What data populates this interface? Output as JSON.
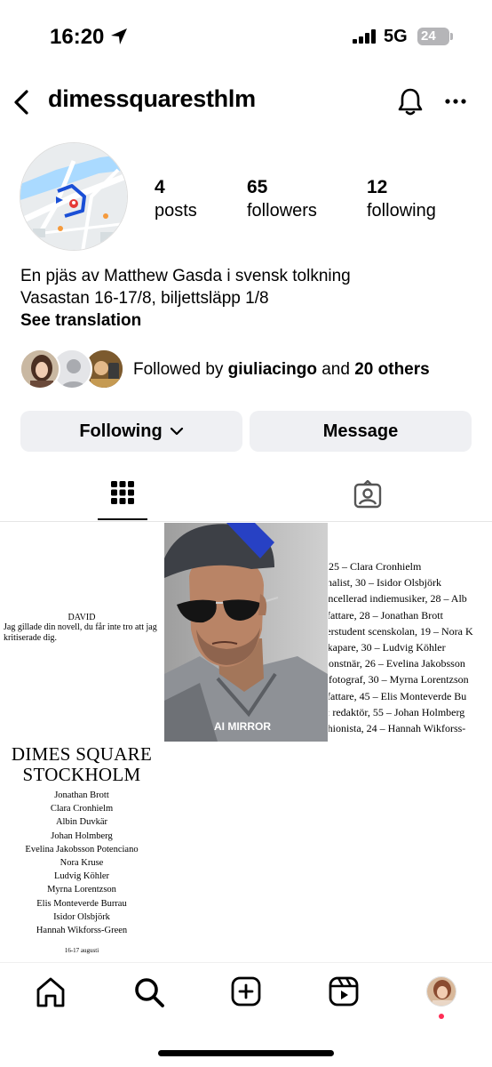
{
  "status_bar": {
    "time": "16:20",
    "network": "5G",
    "battery": "24"
  },
  "header": {
    "username": "dimessquaresthlm"
  },
  "profile": {
    "stats": [
      {
        "count": "4",
        "label": "posts"
      },
      {
        "count": "65",
        "label": "followers"
      },
      {
        "count": "12",
        "label": "following"
      }
    ],
    "bio_line1": "En pjäs av Matthew Gasda i svensk tolkning",
    "bio_line2": "Vasastan 16-17/8, biljettsläpp 1/8",
    "see_translation": "See translation",
    "followed_prefix": "Followed by ",
    "followed_user": "giuliacingo",
    "followed_mid": " and ",
    "followed_others": "20 others"
  },
  "actions": {
    "following_label": "Following",
    "message_label": "Message"
  },
  "posts": {
    "post1": {
      "heading": "DAVID",
      "text": "Jag gillade din novell, du får inte tro att jag kritiserade dig."
    },
    "post2": {
      "watermark": "AI MIRROR"
    },
    "post3": {
      "lines": [
        ", 25 – Clara Cronhielm",
        "rnalist, 30 –  Isidor Olsbjörk",
        "ancellerad indiemusiker, 28 – Alb",
        "rfattare, 28 – Jonathan Brott",
        "terstudent scenskolan, 19 – Nora K",
        "skapare, 30 – Ludvig Köhler",
        " konstnär, 26 – Evelina Jakobsson",
        "nfotograf, 30 – Myrna Lorentzson",
        "rfattare, 45 – Elis Monteverde Bu",
        "r: redaktör, 55 – Johan Holmberg",
        "shionista, 24 – Hannah Wikforss-"
      ]
    },
    "post4": {
      "title_line1": "DIMES SQUARE",
      "title_line2": "STOCKHOLM",
      "cast": [
        "Jonathan Brott",
        "Clara Cronhielm",
        "Albin Duvkär",
        "Johan Holmberg",
        "Evelina Jakobsson Potenciano",
        "Nora Kruse",
        "Ludvig Köhler",
        "Myrna Lorentzson",
        "Elis Monteverde Burrau",
        "Isidor Olsbjörk",
        "Hannah Wikforss-Green"
      ],
      "date": "16-17 augusti"
    }
  },
  "colors": {
    "button_bg": "#eff0f3",
    "activity_dot": "#ff2d55",
    "route_blue": "#1a4fd6"
  }
}
